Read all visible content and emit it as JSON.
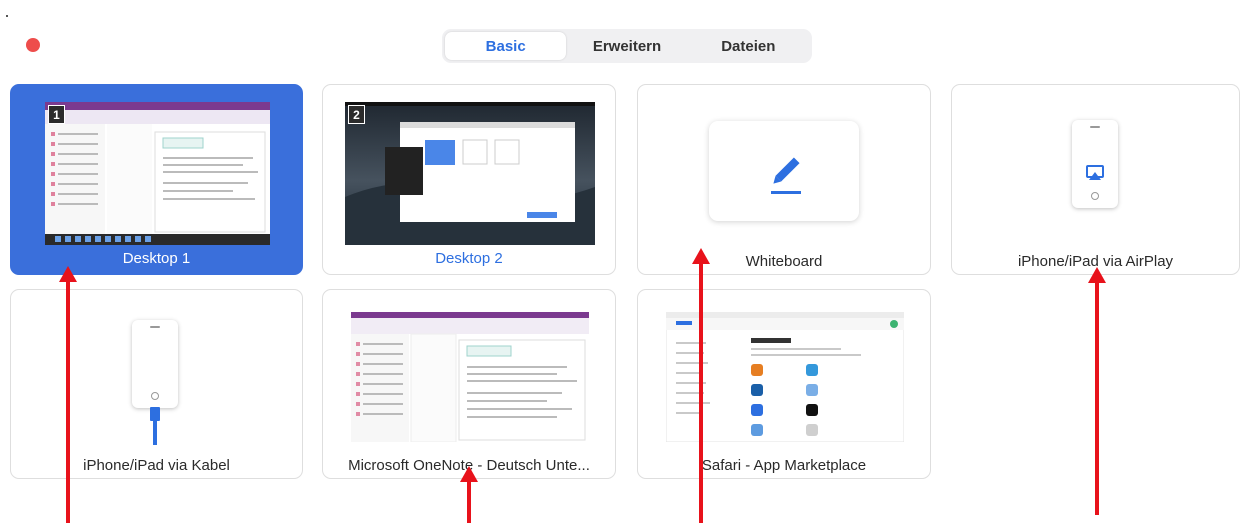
{
  "tabs": [
    {
      "label": "Basic",
      "active": true
    },
    {
      "label": "Erweitern",
      "active": false
    },
    {
      "label": "Dateien",
      "active": false
    }
  ],
  "cards": {
    "desktop1": {
      "label": "Desktop 1",
      "badge": "1",
      "selected": true
    },
    "desktop2": {
      "label": "Desktop 2",
      "badge": "2"
    },
    "whiteboard": {
      "label": "Whiteboard"
    },
    "airplay": {
      "label": "iPhone/iPad via AirPlay"
    },
    "kabel": {
      "label": "iPhone/iPad via Kabel"
    },
    "onenote": {
      "label": "Microsoft OneNote - Deutsch Unte..."
    },
    "safari": {
      "label": "Safari - App Marketplace"
    }
  },
  "colors": {
    "accent": "#2d6fe0",
    "selected": "#3a6fdb",
    "close": "#ee4d4b",
    "annotation_arrow": "#e8121b"
  }
}
